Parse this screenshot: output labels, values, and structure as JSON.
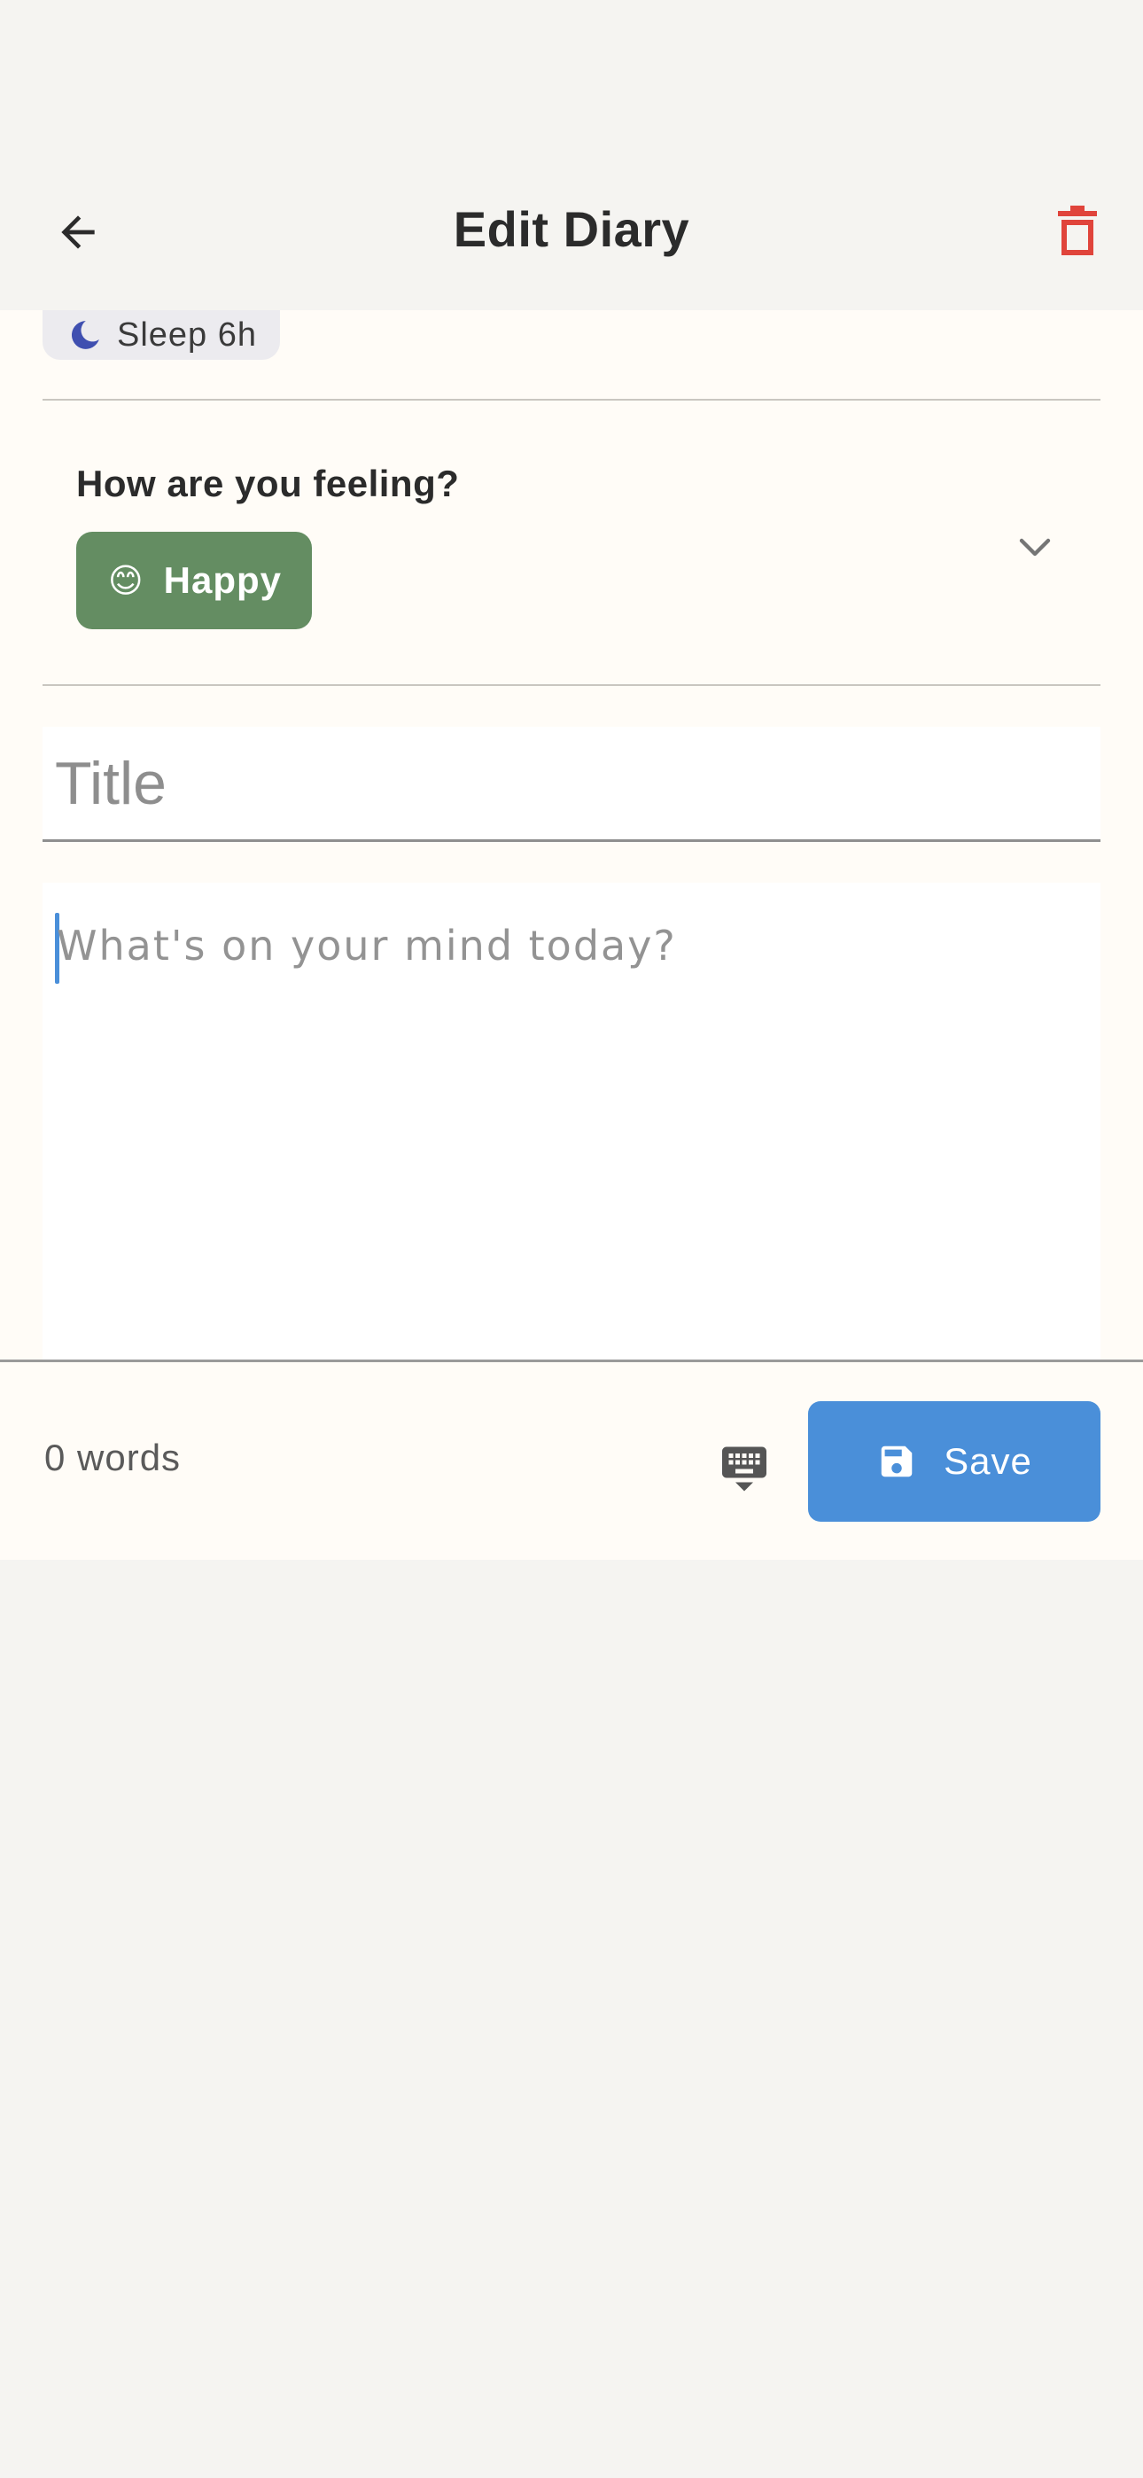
{
  "header": {
    "title": "Edit Diary"
  },
  "sleep": {
    "label": "Sleep 6h"
  },
  "mood": {
    "question": "How are you feeling?",
    "selected": "Happy",
    "emoji": "😊"
  },
  "editor": {
    "title_placeholder": "Title",
    "body_placeholder": "What's on your mind today?"
  },
  "footer": {
    "word_count": "0 words",
    "save_label": "Save"
  },
  "colors": {
    "accent": "#4a8fd9",
    "mood_chip": "#648d62",
    "delete": "#e0443b",
    "moon": "#3f4fb0"
  }
}
